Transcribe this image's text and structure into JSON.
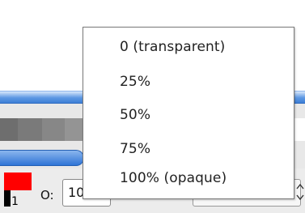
{
  "window": {
    "background": "#ffffff"
  },
  "palette": {
    "swatches": [
      "#6e6e6e",
      "#7a7a7a",
      "#878787",
      "#949494",
      "#a1a1a1",
      "#aeaeae",
      "#bbbbbb",
      "#c8c8c8",
      "#d6d6d6",
      "#e3e3e3",
      "#f0f0f0",
      "#ffffff",
      "#ff0000"
    ]
  },
  "colors": {
    "foreground": "#ff0000",
    "background": "#000000",
    "accent_blue": "#3e7fd6"
  },
  "bottom_bar": {
    "color_index": "1",
    "opacity_label": "O:",
    "opacity_value": "10"
  },
  "opacity_menu": {
    "items": [
      {
        "label": "0 (transparent)"
      },
      {
        "label": "25%"
      },
      {
        "label": "50%"
      },
      {
        "label": "75%"
      },
      {
        "label": "100% (opaque)"
      }
    ]
  },
  "icons": {
    "spin": "up-down-spinner-icon",
    "folder": "folder-icon"
  }
}
